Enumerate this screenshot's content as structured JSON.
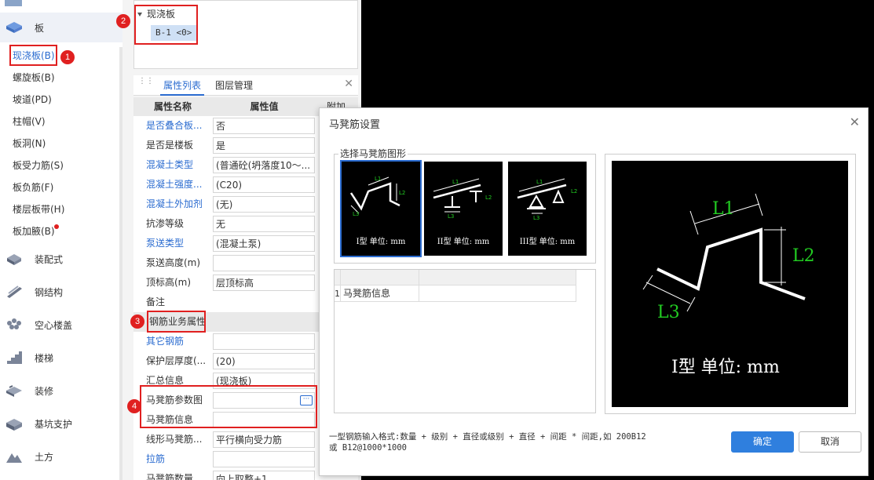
{
  "left_nav": {
    "categories": [
      {
        "label": "板",
        "icon": "slab-icon"
      },
      {
        "label": "装配式",
        "icon": "prefab-icon"
      },
      {
        "label": "钢结构",
        "icon": "steel-structure-icon"
      },
      {
        "label": "空心楼盖",
        "icon": "hollow-floor-icon"
      },
      {
        "label": "楼梯",
        "icon": "stairs-icon"
      },
      {
        "label": "装修",
        "icon": "decoration-icon"
      },
      {
        "label": "基坑支护",
        "icon": "foundation-pit-icon"
      },
      {
        "label": "土方",
        "icon": "earthwork-icon"
      }
    ],
    "sub_items": [
      {
        "label": "现浇板(B)",
        "active": true
      },
      {
        "label": "螺旋板(B)"
      },
      {
        "label": "坡道(PD)"
      },
      {
        "label": "柱帽(V)"
      },
      {
        "label": "板洞(N)"
      },
      {
        "label": "板受力筋(S)"
      },
      {
        "label": "板负筋(F)"
      },
      {
        "label": "楼层板带(H)"
      },
      {
        "label": "板加腋(B)",
        "badge": "red-dot"
      }
    ]
  },
  "tree": {
    "root_label": "现浇板",
    "node_label": "B-1 <0>"
  },
  "prop_panel": {
    "tabs": [
      {
        "label": "属性列表",
        "active": true
      },
      {
        "label": "图层管理",
        "active": false
      }
    ],
    "columns": [
      "属性名称",
      "属性值",
      "附加"
    ],
    "rows": [
      {
        "name": "是否叠合板...",
        "value": "否",
        "blue": true
      },
      {
        "name": "是否是楼板",
        "value": "是",
        "blue": false
      },
      {
        "name": "混凝土类型",
        "value": "(普通砼(坍落度10～...",
        "blue": true
      },
      {
        "name": "混凝土强度...",
        "value": "(C20)",
        "blue": true
      },
      {
        "name": "混凝土外加剂",
        "value": "(无)",
        "blue": true
      },
      {
        "name": "抗渗等级",
        "value": "无",
        "blue": false
      },
      {
        "name": "泵送类型",
        "value": "(混凝土泵)",
        "blue": true
      },
      {
        "name": "泵送高度(m)",
        "value": "",
        "blue": false
      },
      {
        "name": "顶标高(m)",
        "value": "层顶标高",
        "blue": false
      },
      {
        "name": "备注",
        "value": "",
        "blue": false
      },
      {
        "name": "钢筋业务属性",
        "value": "",
        "section": true
      },
      {
        "name": "其它钢筋",
        "value": "",
        "blue": true
      },
      {
        "name": "保护层厚度(...",
        "value": "(20)",
        "blue": false
      },
      {
        "name": "汇总信息",
        "value": "(现浇板)",
        "blue": false
      },
      {
        "name": "马凳筋参数图",
        "value": "",
        "blue": false,
        "ellipsis": true
      },
      {
        "name": "马凳筋信息",
        "value": "",
        "blue": false
      },
      {
        "name": "线形马凳筋...",
        "value": "平行横向受力筋",
        "blue": false
      },
      {
        "name": "拉筋",
        "value": "",
        "blue": true
      },
      {
        "name": "马凳筋数量...",
        "value": "向上取整+1",
        "blue": false
      }
    ],
    "ellipsis_label": "···"
  },
  "dialog": {
    "title": "马凳筋设置",
    "close_icon": "close-icon",
    "select_shape_legend": "选择马凳筋图形",
    "shapes": [
      {
        "label": "I型 单位: mm",
        "selected": true
      },
      {
        "label": "II型 单位: mm",
        "selected": false
      },
      {
        "label": "III型 单位: mm",
        "selected": false
      }
    ],
    "grid": {
      "rows": [
        {
          "index": "1",
          "label": "马凳筋信息",
          "value": ""
        }
      ]
    },
    "preview": {
      "labels": {
        "l1": "L1",
        "l2": "L2",
        "l3": "L3"
      },
      "caption": "I型 单位: mm"
    },
    "thumb_labels": {
      "l1": "L1",
      "l2": "L2",
      "l3": "L3"
    },
    "note_line1": "一型钢筋输入格式:数量 + 级别 + 直径或级别 + 直径 + 间距 * 间距,如 200B12",
    "note_line2": "或 B12@1000*1000",
    "ok_label": "确定",
    "cancel_label": "取消"
  },
  "annotations": [
    "1",
    "2",
    "3",
    "4"
  ],
  "colors": {
    "accent_blue": "#2b6cd0",
    "annotation_red": "#e02020",
    "cad_background": "#000000",
    "label_green": "#22cc22",
    "ok_button": "#2f7fde"
  }
}
